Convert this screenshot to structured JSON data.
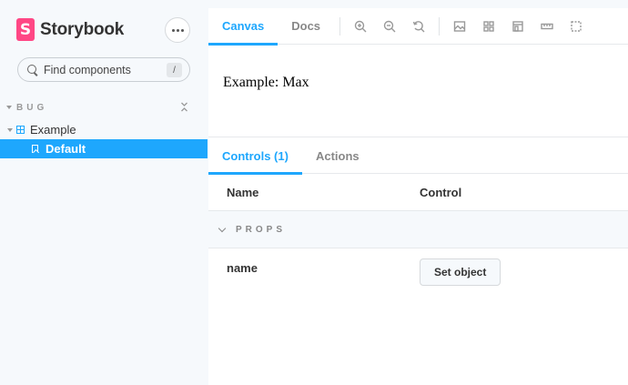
{
  "sidebar": {
    "brand": {
      "logo_letter": "S",
      "name": "Storybook"
    },
    "search": {
      "placeholder": "Find components",
      "shortcut": "/"
    },
    "group": {
      "label": "BUG"
    },
    "component": {
      "label": "Example"
    },
    "story": {
      "label": "Default"
    }
  },
  "toolbar": {
    "tabs": [
      {
        "label": "Canvas",
        "active": true
      },
      {
        "label": "Docs",
        "active": false
      }
    ],
    "tools": [
      "zoom-in-icon",
      "zoom-out-icon",
      "zoom-reset-icon",
      "background-icon",
      "grid-icon",
      "viewport-icon",
      "measure-icon",
      "outline-icon"
    ]
  },
  "canvas": {
    "content": "Example: Max"
  },
  "addons": {
    "tabs": [
      {
        "label": "Controls (1)",
        "active": true
      },
      {
        "label": "Actions",
        "active": false
      }
    ],
    "table": {
      "headers": {
        "name": "Name",
        "control": "Control"
      },
      "section": "PROPS",
      "rows": [
        {
          "name": "name",
          "control_label": "Set object"
        }
      ]
    }
  },
  "colors": {
    "accent": "#1ea7fd",
    "brand": "#ff4785"
  }
}
